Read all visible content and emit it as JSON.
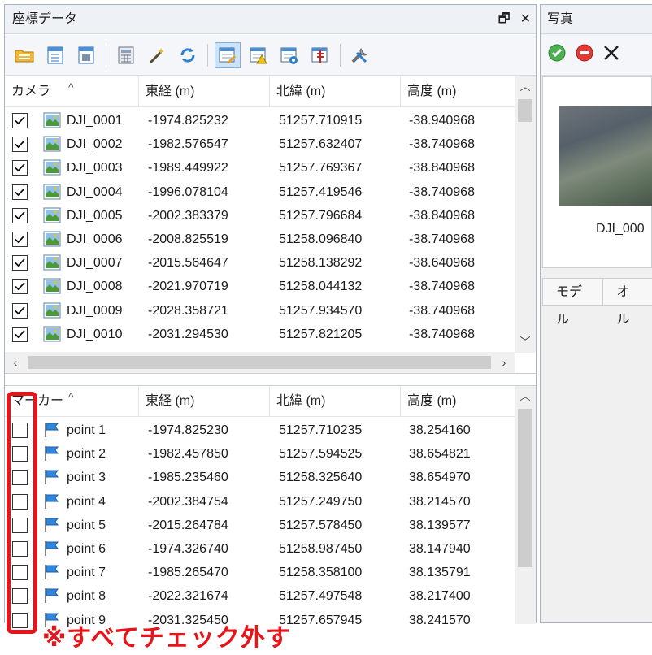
{
  "coords_panel": {
    "title": "座標データ",
    "float_glyph": "🗗",
    "close_glyph": "✕"
  },
  "photo_panel": {
    "title": "写真",
    "photo_name": "DJI_000",
    "tabs": [
      "モデル",
      "オル"
    ]
  },
  "toolbar_icons": [
    "open-folder-icon",
    "import-icon",
    "export-icon",
    "calculator-icon",
    "wand-icon",
    "refresh-icon",
    "edit-table-icon",
    "warning-table-icon",
    "settings-table-icon",
    "align-table-icon",
    "tools-icon"
  ],
  "camera_table": {
    "columns": [
      "カメラ",
      "東経 (m)",
      "北緯 (m)",
      "高度 (m)"
    ],
    "rows": [
      {
        "name": "DJI_0001",
        "east": "-1974.825232",
        "north": "51257.710915",
        "alt": "-38.940968",
        "checked": true
      },
      {
        "name": "DJI_0002",
        "east": "-1982.576547",
        "north": "51257.632407",
        "alt": "-38.740968",
        "checked": true
      },
      {
        "name": "DJI_0003",
        "east": "-1989.449922",
        "north": "51257.769367",
        "alt": "-38.840968",
        "checked": true
      },
      {
        "name": "DJI_0004",
        "east": "-1996.078104",
        "north": "51257.419546",
        "alt": "-38.740968",
        "checked": true
      },
      {
        "name": "DJI_0005",
        "east": "-2002.383379",
        "north": "51257.796684",
        "alt": "-38.840968",
        "checked": true
      },
      {
        "name": "DJI_0006",
        "east": "-2008.825519",
        "north": "51258.096840",
        "alt": "-38.740968",
        "checked": true
      },
      {
        "name": "DJI_0007",
        "east": "-2015.564647",
        "north": "51258.138292",
        "alt": "-38.640968",
        "checked": true
      },
      {
        "name": "DJI_0008",
        "east": "-2021.970719",
        "north": "51258.044132",
        "alt": "-38.740968",
        "checked": true
      },
      {
        "name": "DJI_0009",
        "east": "-2028.358721",
        "north": "51257.934570",
        "alt": "-38.740968",
        "checked": true
      },
      {
        "name": "DJI_0010",
        "east": "-2031.294530",
        "north": "51257.821205",
        "alt": "-38.740968",
        "checked": true
      }
    ]
  },
  "marker_table": {
    "columns": [
      "マーカー",
      "東経 (m)",
      "北緯 (m)",
      "高度 (m)"
    ],
    "rows": [
      {
        "name": "point 1",
        "east": "-1974.825230",
        "north": "51257.710235",
        "alt": "38.254160",
        "checked": false
      },
      {
        "name": "point 2",
        "east": "-1982.457850",
        "north": "51257.594525",
        "alt": "38.654821",
        "checked": false
      },
      {
        "name": "point 3",
        "east": "-1985.235460",
        "north": "51258.325640",
        "alt": "38.654970",
        "checked": false
      },
      {
        "name": "point 4",
        "east": "-2002.384754",
        "north": "51257.249750",
        "alt": "38.214570",
        "checked": false
      },
      {
        "name": "point 5",
        "east": "-2015.264784",
        "north": "51257.578450",
        "alt": "38.139577",
        "checked": false
      },
      {
        "name": "point 6",
        "east": "-1974.326740",
        "north": "51258.987450",
        "alt": "38.147940",
        "checked": false
      },
      {
        "name": "point 7",
        "east": "-1985.265470",
        "north": "51258.358100",
        "alt": "38.135791",
        "checked": false
      },
      {
        "name": "point 8",
        "east": "-2022.321674",
        "north": "51257.497548",
        "alt": "38.217400",
        "checked": false
      },
      {
        "name": "point 9",
        "east": "-2031.325450",
        "north": "51257.657945",
        "alt": "38.241570",
        "checked": false
      }
    ]
  },
  "annotation": {
    "note": "※すべてチェック外す",
    "color": "#e8141b"
  }
}
